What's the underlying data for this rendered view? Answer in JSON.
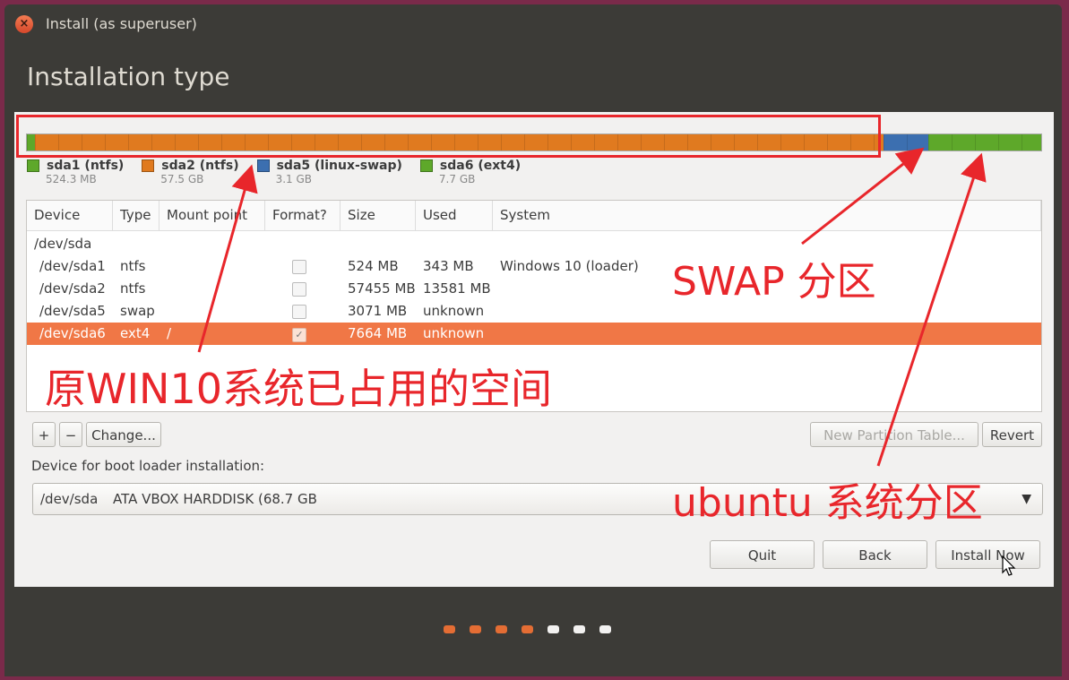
{
  "window": {
    "title": "Install (as superuser)",
    "heading": "Installation type"
  },
  "partition_bar": [
    {
      "name": "sda1 (ntfs)",
      "size": "524.3 MB",
      "color": "#5ea82a",
      "fraction": 0.0076
    },
    {
      "name": "sda2 (ntfs)",
      "size": "57.5 GB",
      "color": "#e07a1f",
      "fraction": 0.837
    },
    {
      "name": "sda5 (linux-swap)",
      "size": "3.1 GB",
      "color": "#3c6fb0",
      "fraction": 0.045
    },
    {
      "name": "sda6 (ext4)",
      "size": "7.7 GB",
      "color": "#5ea82a",
      "fraction": 0.111
    }
  ],
  "table": {
    "columns": [
      "Device",
      "Type",
      "Mount point",
      "Format?",
      "Size",
      "Used",
      "System"
    ],
    "rows": [
      {
        "device": "/dev/sda",
        "type": "",
        "mount": "",
        "format": null,
        "size": "",
        "used": "",
        "system": ""
      },
      {
        "device": "/dev/sda1",
        "type": "ntfs",
        "mount": "",
        "format": false,
        "size": "524 MB",
        "used": "343 MB",
        "system": "Windows 10 (loader)"
      },
      {
        "device": "/dev/sda2",
        "type": "ntfs",
        "mount": "",
        "format": false,
        "size": "57455 MB",
        "used": "13581 MB",
        "system": ""
      },
      {
        "device": "/dev/sda5",
        "type": "swap",
        "mount": "",
        "format": false,
        "size": "3071 MB",
        "used": "unknown",
        "system": ""
      },
      {
        "device": "/dev/sda6",
        "type": "ext4",
        "mount": "/",
        "format": true,
        "size": "7664 MB",
        "used": "unknown",
        "system": "",
        "selected": true
      }
    ]
  },
  "controls": {
    "add": "+",
    "remove": "−",
    "change": "Change...",
    "new_table": "New Partition Table...",
    "revert": "Revert"
  },
  "boot": {
    "label": "Device for boot loader installation:",
    "device": "/dev/sda",
    "description": "ATA VBOX HARDDISK (68.7 GB"
  },
  "buttons": {
    "quit": "Quit",
    "back": "Back",
    "install": "Install Now"
  },
  "progress_dots": {
    "total": 7,
    "completed": 4,
    "active_color": "#e46d34",
    "inactive_color": "#f2f1f0"
  },
  "annotations": {
    "win10": "原WIN10系统已占用的空间",
    "swap": "SWAP 分区",
    "ubuntu": "ubuntu 系统分区",
    "color": "#e8262b"
  }
}
